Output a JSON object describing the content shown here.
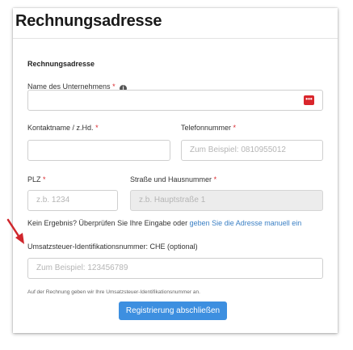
{
  "page": {
    "title": "Rechnungsadresse",
    "section_title": "Rechnungsadresse"
  },
  "form": {
    "company": {
      "label": "Name des Unternehmens",
      "required_mark": "*",
      "info_icon": "info-icon",
      "value": "",
      "field_icon": "password-manager-icon",
      "field_icon_glyph": "•••"
    },
    "contact": {
      "label": "Kontaktname / z.Hd.",
      "required_mark": "*",
      "value": ""
    },
    "phone": {
      "label": "Telefonnummer",
      "required_mark": "*",
      "placeholder": "Zum Beispiel: 0810955012"
    },
    "zip": {
      "label": "PLZ",
      "required_mark": "*",
      "placeholder": "z.b. 1234"
    },
    "street": {
      "label": "Straße und Hausnummer",
      "required_mark": "*",
      "placeholder": "z.b. Hauptstraße 1"
    },
    "no_result": {
      "text": "Kein Ergebnis? Überprüfen Sie Ihre Eingabe oder",
      "link": "geben Sie die Adresse manuell ein"
    },
    "vat": {
      "label": "Umsatzsteuer-Identifikationsnummer: CHE (optional)",
      "placeholder": "Zum Beispiel: 123456789",
      "note": "Auf der Rechnung geben wir Ihre Umsatzsteuer-Identifikationsnummer an."
    },
    "submit_label": "Registrierung abschließen"
  },
  "colors": {
    "accent": "#3d8fe0",
    "required": "#d9262c",
    "link": "#3a7fc4",
    "arrow": "#d0262c"
  }
}
